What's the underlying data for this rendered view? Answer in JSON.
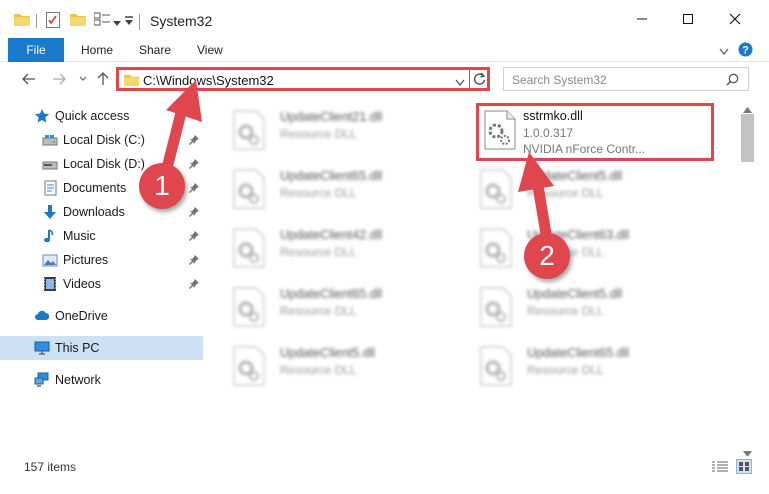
{
  "window": {
    "title": "System32",
    "minimize_label": "Minimize",
    "maximize_label": "Maximize",
    "close_label": "Close"
  },
  "ribbon": {
    "tabs": [
      {
        "label": "File"
      },
      {
        "label": "Home"
      },
      {
        "label": "Share"
      },
      {
        "label": "View"
      }
    ]
  },
  "address": {
    "path": "C:\\Windows\\System32"
  },
  "search": {
    "placeholder": "Search System32"
  },
  "sidebar": {
    "items": [
      {
        "label": "Quick access",
        "icon": "star-icon"
      },
      {
        "label": "Local Disk (C:)",
        "icon": "drive-icon"
      },
      {
        "label": "Local Disk (D:)",
        "icon": "drive-icon"
      },
      {
        "label": "Documents",
        "icon": "documents-icon"
      },
      {
        "label": "Downloads",
        "icon": "download-icon"
      },
      {
        "label": "Music",
        "icon": "music-icon"
      },
      {
        "label": "Pictures",
        "icon": "pictures-icon"
      },
      {
        "label": "Videos",
        "icon": "videos-icon"
      },
      {
        "label": "OneDrive",
        "icon": "cloud-icon"
      },
      {
        "label": "This PC",
        "icon": "computer-icon"
      },
      {
        "label": "Network",
        "icon": "network-icon"
      }
    ]
  },
  "files": {
    "target": {
      "name": "sstrmko.dll",
      "version": "1.0.0.317",
      "description": "NVIDIA nForce Contr..."
    },
    "left_column": [
      {
        "name": "UpdateClient21.dll",
        "type": "Resource DLL"
      },
      {
        "name": "UpdateClient65.dll",
        "type": "Resource DLL"
      },
      {
        "name": "UpdateClient42.dll",
        "type": "Resource DLL"
      },
      {
        "name": "UpdateClient65.dll",
        "type": "Resource DLL"
      },
      {
        "name": "UpdateClient5.dll",
        "type": "Resource DLL"
      }
    ],
    "right_column": [
      {
        "name": "UpdateClient5.dll",
        "type": "Resource DLL"
      },
      {
        "name": "UpdateClient63.dll",
        "type": "Resource DLL"
      },
      {
        "name": "UpdateClient5.dll",
        "type": "Resource DLL"
      },
      {
        "name": "UpdateClient65.dll",
        "type": "Resource DLL"
      }
    ]
  },
  "status": {
    "item_count": "157 items"
  },
  "annotations": {
    "step1": "1",
    "step2": "2"
  },
  "colors": {
    "accent": "#1979ca",
    "highlight_red": "#e0464e",
    "selected_bg": "#cce1f4"
  }
}
